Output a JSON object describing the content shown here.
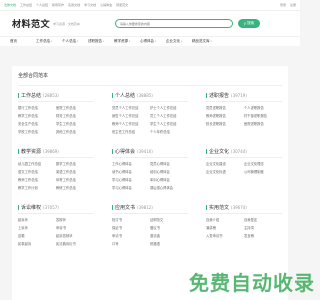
{
  "topbar": {
    "left": [
      "法律文档",
      "工作总结",
      "个人总结",
      "职场写作",
      "实用文档",
      "学习文档",
      "心得体会",
      "阿里范文"
    ],
    "right": [
      "登录",
      "注册"
    ]
  },
  "header": {
    "logo_main": "材料范文",
    "logo_sub": "学习资源 · 文档范本",
    "search_placeholder": "请输入你要搜索的内容",
    "search_button": "搜索"
  },
  "nav": {
    "items": [
      "首页",
      "工作总结",
      "个人总结",
      "述职报告",
      "教学资源",
      "心得体会",
      "企业文化",
      "精品范文库"
    ]
  },
  "panel": {
    "title": "全部合同范本",
    "categories": [
      {
        "name": "工作总结",
        "count": "(28853)",
        "links": [
          "银行工作总结",
          "医院工作总结",
          "教学工作总结",
          "财务工作总结",
          "安全生产总结",
          "学生工作总结",
          "学校工作总结",
          "其他工作总结"
        ]
      },
      {
        "name": "个人总结",
        "count": "(38885)",
        "links": [
          "党员个人工作总结",
          "护士个人工作总结",
          "销售个人工作总结",
          "员工个人工作总结",
          "教师个人工作总结",
          "学生个人工作总结",
          "班主任工作总结",
          "个人年终总结"
        ]
      },
      {
        "name": "述职报告",
        "count": "(39719)",
        "links": [
          "党员述职报告",
          "个人述职报告",
          "教师述职报告",
          "村干部述职报告",
          "校长述职报告",
          "医院述职报告"
        ]
      },
      {
        "name": "教学资源",
        "count": "(39869)",
        "links": [
          "幼儿园工作总结",
          "数学工作总结",
          "语文工作总结",
          "英语工作总结",
          "教师工作总结",
          "体育工作总结",
          "教学工作计划",
          "教研工作总结"
        ]
      },
      {
        "name": "心得体会",
        "count": "(39416)",
        "links": [
          "工作心得体会",
          "党员心得体会",
          "读书心得体会",
          "培训心得体会",
          "学习心得体会",
          "军训心得体会",
          "学习心得体会",
          "观后感心得体会"
        ]
      },
      {
        "name": "企业文化",
        "count": "(30744)",
        "links": [
          "企业文化建设",
          "企业文化理念",
          "企业文化标语",
          "公司管理制度"
        ]
      },
      {
        "name": "诉讼维权",
        "count": "(37057)",
        "links": [
          "起诉状",
          "答辩状",
          "上诉状",
          "申诉书",
          "遗嘱",
          "起诉答辩状",
          "民事起诉",
          "民法典诉讼书"
        ]
      },
      {
        "name": "应用文书",
        "count": "(39812)",
        "links": [
          "检讨书",
          "证明范文",
          "保证书",
          "倡议书",
          "申请书",
          "邀请函",
          "口号",
          "祝福语"
        ]
      },
      {
        "name": "实用范文",
        "count": "(39674)",
        "links": [
          "自我介绍",
          "自我鉴定",
          "演讲稿",
          "主持词",
          "入党申请书",
          "发言稿"
        ]
      }
    ]
  },
  "watermark": "免费自动收录",
  "colors": {
    "accent": "#36b37e"
  }
}
